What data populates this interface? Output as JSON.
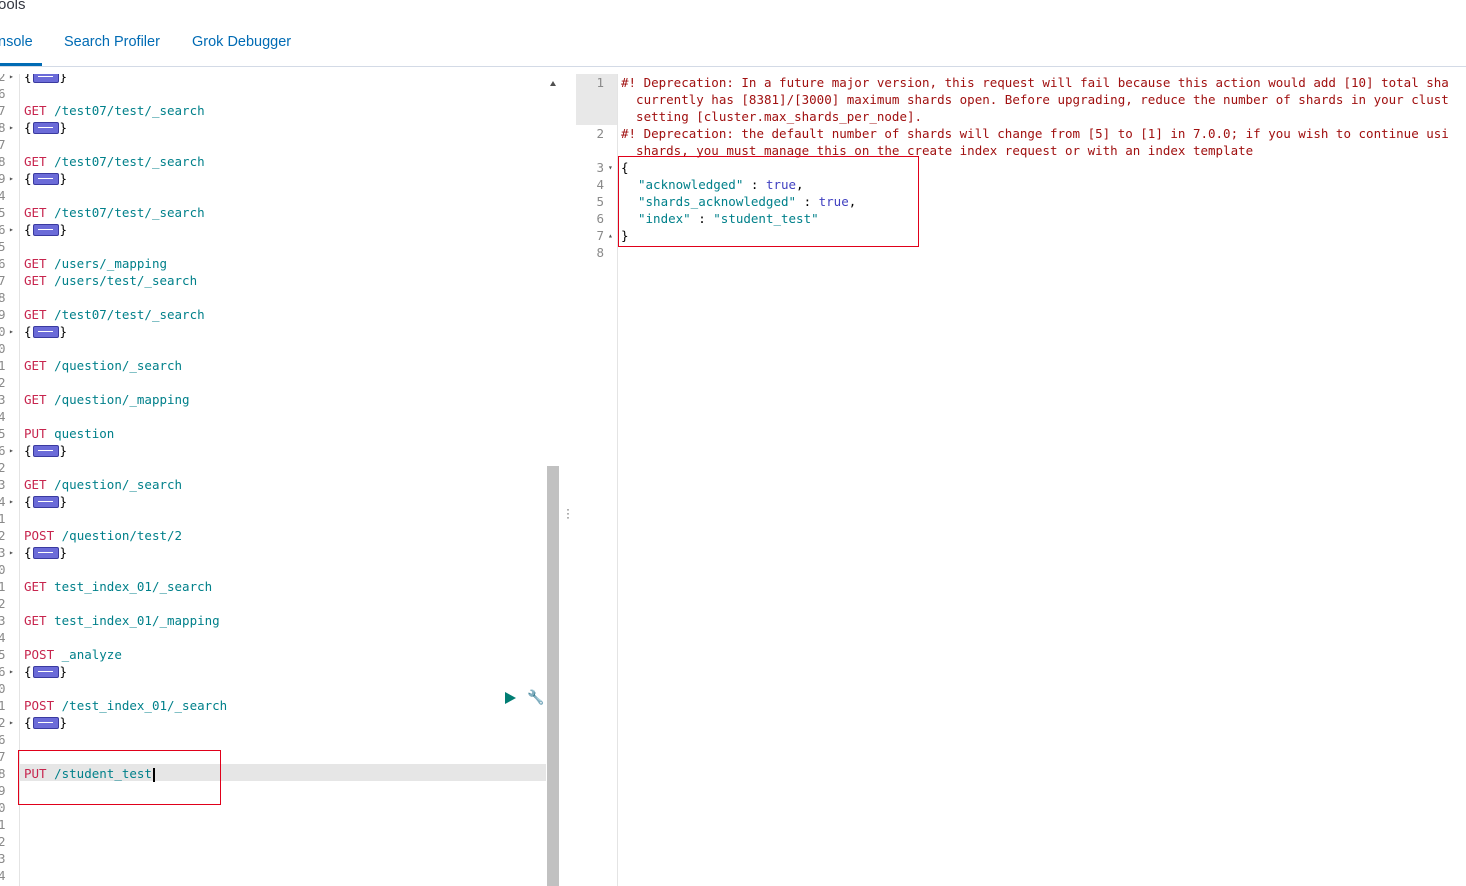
{
  "app": {
    "title": "ools"
  },
  "tabs": [
    {
      "label": "nsole",
      "active": true
    },
    {
      "label": "Search Profiler",
      "active": false
    },
    {
      "label": "Grok Debugger",
      "active": false
    }
  ],
  "editor": {
    "lines": [
      {
        "n": "2",
        "fold": true,
        "method": "",
        "path": "",
        "collapsed": true
      },
      {
        "n": "6",
        "fold": false,
        "method": "",
        "path": ""
      },
      {
        "n": "7",
        "fold": false,
        "method": "GET",
        "path": "/test07/test/_search"
      },
      {
        "n": "8",
        "fold": true,
        "method": "",
        "path": "",
        "collapsed": true
      },
      {
        "n": "7",
        "fold": false,
        "method": "",
        "path": ""
      },
      {
        "n": "8",
        "fold": false,
        "method": "GET",
        "path": "/test07/test/_search"
      },
      {
        "n": "9",
        "fold": true,
        "method": "",
        "path": "",
        "collapsed": true
      },
      {
        "n": "4",
        "fold": false,
        "method": "",
        "path": ""
      },
      {
        "n": "5",
        "fold": false,
        "method": "GET",
        "path": "/test07/test/_search"
      },
      {
        "n": "6",
        "fold": true,
        "method": "",
        "path": "",
        "collapsed": true
      },
      {
        "n": "5",
        "fold": false,
        "method": "",
        "path": ""
      },
      {
        "n": "6",
        "fold": false,
        "method": "GET",
        "path": "/users/_mapping"
      },
      {
        "n": "7",
        "fold": false,
        "method": "GET",
        "path": "/users/test/_search"
      },
      {
        "n": "8",
        "fold": false,
        "method": "",
        "path": ""
      },
      {
        "n": "9",
        "fold": false,
        "method": "GET",
        "path": "/test07/test/_search"
      },
      {
        "n": "0",
        "fold": true,
        "method": "",
        "path": "",
        "collapsed": true
      },
      {
        "n": "0",
        "fold": false,
        "method": "",
        "path": ""
      },
      {
        "n": "1",
        "fold": false,
        "method": "GET",
        "path": "/question/_search"
      },
      {
        "n": "2",
        "fold": false,
        "method": "",
        "path": ""
      },
      {
        "n": "3",
        "fold": false,
        "method": "GET",
        "path": "/question/_mapping"
      },
      {
        "n": "4",
        "fold": false,
        "method": "",
        "path": ""
      },
      {
        "n": "5",
        "fold": false,
        "method": "PUT",
        "path": "question"
      },
      {
        "n": "6",
        "fold": true,
        "method": "",
        "path": "",
        "collapsed": true
      },
      {
        "n": "2",
        "fold": false,
        "method": "",
        "path": ""
      },
      {
        "n": "3",
        "fold": false,
        "method": "GET",
        "path": "/question/_search"
      },
      {
        "n": "4",
        "fold": true,
        "method": "",
        "path": "",
        "collapsed": true
      },
      {
        "n": "1",
        "fold": false,
        "method": "",
        "path": ""
      },
      {
        "n": "2",
        "fold": false,
        "method": "POST",
        "path": "/question/test/2"
      },
      {
        "n": "3",
        "fold": true,
        "method": "",
        "path": "",
        "collapsed": true
      },
      {
        "n": "0",
        "fold": false,
        "method": "",
        "path": ""
      },
      {
        "n": "1",
        "fold": false,
        "method": "GET",
        "path": "test_index_01/_search"
      },
      {
        "n": "2",
        "fold": false,
        "method": "",
        "path": ""
      },
      {
        "n": "3",
        "fold": false,
        "method": "GET",
        "path": "test_index_01/_mapping"
      },
      {
        "n": "4",
        "fold": false,
        "method": "",
        "path": ""
      },
      {
        "n": "5",
        "fold": false,
        "method": "POST",
        "path": "_analyze"
      },
      {
        "n": "6",
        "fold": true,
        "method": "",
        "path": "",
        "collapsed": true
      },
      {
        "n": "0",
        "fold": false,
        "method": "",
        "path": ""
      },
      {
        "n": "1",
        "fold": false,
        "method": "POST",
        "path": "/test_index_01/_search"
      },
      {
        "n": "2",
        "fold": true,
        "method": "",
        "path": "",
        "collapsed": true
      },
      {
        "n": "6",
        "fold": false,
        "method": "",
        "path": ""
      },
      {
        "n": "7",
        "fold": false,
        "method": "",
        "path": ""
      },
      {
        "n": "8",
        "fold": false,
        "method": "PUT",
        "path": "/student_test",
        "active": true
      },
      {
        "n": "9",
        "fold": false,
        "method": "",
        "path": ""
      },
      {
        "n": "0",
        "fold": false,
        "method": "",
        "path": ""
      },
      {
        "n": "1",
        "fold": false,
        "method": "",
        "path": ""
      },
      {
        "n": "2",
        "fold": false,
        "method": "",
        "path": ""
      },
      {
        "n": "3",
        "fold": false,
        "method": "",
        "path": ""
      },
      {
        "n": "4",
        "fold": false,
        "method": "",
        "path": ""
      }
    ],
    "brace_open": "{",
    "brace_close": "}"
  },
  "output": {
    "warning_lines": [
      {
        "n": "1",
        "text": "#! Deprecation: In a future major version, this request will fail because this action would add [10] total sha"
      },
      {
        "n": "",
        "text": "  currently has [8381]/[3000] maximum shards open. Before upgrading, reduce the number of shards in your clust"
      },
      {
        "n": "",
        "text": "  setting [cluster.max_shards_per_node]."
      },
      {
        "n": "2",
        "text": "#! Deprecation: the default number of shards will change from [5] to [1] in 7.0.0; if you wish to continue usi"
      },
      {
        "n": "",
        "text": "  shards, you must manage this on the create index request or with an index template"
      }
    ],
    "json_lines": [
      {
        "n": "3",
        "fold": "down",
        "text": "{"
      },
      {
        "n": "4",
        "key": "\"acknowledged\"",
        "sep": " : ",
        "value": "true",
        "vtype": "bool",
        "tail": ","
      },
      {
        "n": "5",
        "key": "\"shards_acknowledged\"",
        "sep": " : ",
        "value": "true",
        "vtype": "bool",
        "tail": ","
      },
      {
        "n": "6",
        "key": "\"index\"",
        "sep": " : ",
        "value": "\"student_test\"",
        "vtype": "str",
        "tail": ""
      },
      {
        "n": "7",
        "fold": "up",
        "text": "}"
      },
      {
        "n": "8",
        "text": ""
      }
    ]
  }
}
